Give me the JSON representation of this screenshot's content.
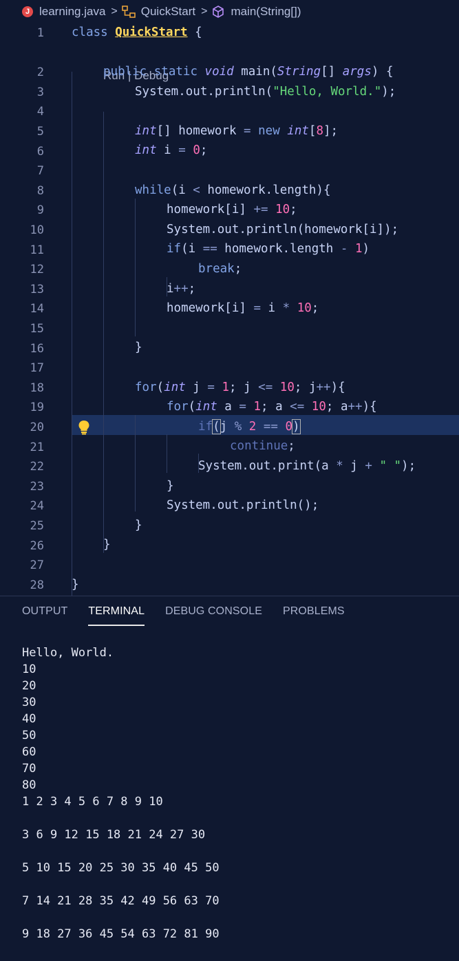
{
  "breadcrumb": {
    "file": "learning.java",
    "file_icon_letter": "J",
    "class": "QuickStart",
    "method": "main(String[])",
    "sep": ">"
  },
  "codelens": {
    "run": "Run",
    "sep": " | ",
    "debug": "Debug"
  },
  "line_numbers": [
    "1",
    "2",
    "3",
    "4",
    "5",
    "6",
    "7",
    "8",
    "9",
    "10",
    "11",
    "12",
    "13",
    "14",
    "15",
    "16",
    "17",
    "18",
    "19",
    "20",
    "21",
    "22",
    "23",
    "24",
    "25",
    "26",
    "27",
    "28"
  ],
  "panel": {
    "tabs": [
      "OUTPUT",
      "TERMINAL",
      "DEBUG CONSOLE",
      "PROBLEMS"
    ],
    "active_tab": "TERMINAL"
  },
  "terminal_lines": [
    "Hello, World.",
    "10",
    "20",
    "30",
    "40",
    "50",
    "60",
    "70",
    "80",
    "1 2 3 4 5 6 7 8 9 10",
    "",
    "3 6 9 12 15 18 21 24 27 30",
    "",
    "5 10 15 20 25 30 35 40 45 50",
    "",
    "7 14 21 28 35 42 49 56 63 70",
    "",
    "9 18 27 36 45 54 63 72 81 90"
  ],
  "colors": {
    "background": "#0f1830",
    "highlight_line": "#1c3260",
    "keyword": "#82a3e6",
    "type": "#a6a1ff",
    "class_name": "#ffd75e",
    "string": "#66d97a",
    "number": "#ff6fb6"
  },
  "icons": {
    "file": "java-file-icon",
    "class": "class-symbol-icon",
    "method": "method-cube-icon",
    "lightbulb": "lightbulb-icon"
  }
}
